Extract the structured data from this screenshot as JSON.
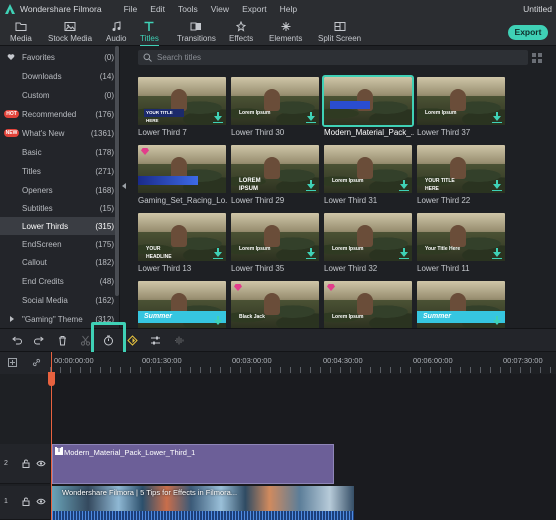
{
  "app": {
    "name": "Wondershare Filmora",
    "doc_title": "Untitled"
  },
  "menu": [
    "File",
    "Edit",
    "Tools",
    "View",
    "Export",
    "Help"
  ],
  "toolbar": {
    "tabs": [
      {
        "label": "Media",
        "icon": "folder-icon"
      },
      {
        "label": "Stock Media",
        "icon": "stock-media-icon"
      },
      {
        "label": "Audio",
        "icon": "music-note-icon"
      },
      {
        "label": "Titles",
        "icon": "text-t-icon"
      },
      {
        "label": "Transitions",
        "icon": "transitions-icon"
      },
      {
        "label": "Effects",
        "icon": "effects-icon"
      },
      {
        "label": "Elements",
        "icon": "elements-icon"
      },
      {
        "label": "Split Screen",
        "icon": "split-screen-icon"
      }
    ],
    "active_tab": "Titles",
    "export_label": "Export"
  },
  "sidebar": {
    "items": [
      {
        "label": "Favorites",
        "count": "(0)"
      },
      {
        "label": "Downloads",
        "count": "(14)"
      },
      {
        "label": "Custom",
        "count": "(0)"
      },
      {
        "label": "Recommended",
        "count": "(176)",
        "badge": "HOT"
      },
      {
        "label": "What's New",
        "count": "(1361)",
        "badge": "NEW"
      },
      {
        "label": "Basic",
        "count": "(178)"
      },
      {
        "label": "Titles",
        "count": "(271)"
      },
      {
        "label": "Openers",
        "count": "(168)"
      },
      {
        "label": "Subtitles",
        "count": "(15)"
      },
      {
        "label": "Lower Thirds",
        "count": "(315)",
        "active": true
      },
      {
        "label": "EndScreen",
        "count": "(175)"
      },
      {
        "label": "Callout",
        "count": "(182)"
      },
      {
        "label": "End Credits",
        "count": "(48)"
      },
      {
        "label": "Social Media",
        "count": "(162)"
      },
      {
        "label": "\"Gaming\" Theme",
        "count": "(312)"
      }
    ]
  },
  "search": {
    "placeholder": "Search titles"
  },
  "grid": {
    "cards": [
      {
        "label": "Lower Third 7",
        "overlay": "YOUR TITLE HERE"
      },
      {
        "label": "Lower Third 30",
        "overlay": "Lorem Ipsum"
      },
      {
        "label": "Modern_Material_Pack_...",
        "overlay": "",
        "selected": true
      },
      {
        "label": "Lower Third 37",
        "overlay": "Lorem Ipsum"
      },
      {
        "label": "Gaming_Set_Racing_Lo...",
        "overlay": "",
        "gem": true
      },
      {
        "label": "Lower Third 29",
        "overlay": "LOREM IPSUM"
      },
      {
        "label": "Lower Third 31",
        "overlay": "Lorem Ipsum"
      },
      {
        "label": "Lower Third 22",
        "overlay": "YOUR TITLE HERE"
      },
      {
        "label": "Lower Third 13",
        "overlay": "YOUR HEADLINE HERE"
      },
      {
        "label": "Lower Third 35",
        "overlay": "Lorem Ipsum"
      },
      {
        "label": "Lower Third 32",
        "overlay": "Lorem Ipsum"
      },
      {
        "label": "Lower Third 11",
        "overlay": "Your Title Here"
      },
      {
        "label": "",
        "overlay": "Summer"
      },
      {
        "label": "",
        "overlay": "Black Jack",
        "gem": true
      },
      {
        "label": "",
        "overlay": "Lorem Ipsum",
        "gem": true
      },
      {
        "label": "",
        "overlay": "Summer"
      }
    ]
  },
  "timeline": {
    "toolbar_icons": [
      "undo-icon",
      "redo-icon",
      "delete-icon",
      "cut-icon",
      "speed-timer-icon",
      "color-match-icon",
      "adjust-icon",
      "audio-waveform-icon"
    ],
    "ruler_labels": [
      "00:00:00:00",
      "00:01:30:00",
      "00:03:00:00",
      "00:04:30:00",
      "00:06:00:00",
      "00:07:30:00"
    ],
    "tracks": [
      {
        "number": "2",
        "clip_label": "Modern_Material_Pack_Lower_Third_1",
        "clip_type": "title"
      },
      {
        "number": "1",
        "clip_label": "Wondershare Filmora | 5 Tips for Effects in Filmora...",
        "clip_type": "video"
      }
    ]
  },
  "colors": {
    "accent": "#3fd1b6",
    "playhead": "#e8623f",
    "title_clip": "#6c5f98"
  }
}
